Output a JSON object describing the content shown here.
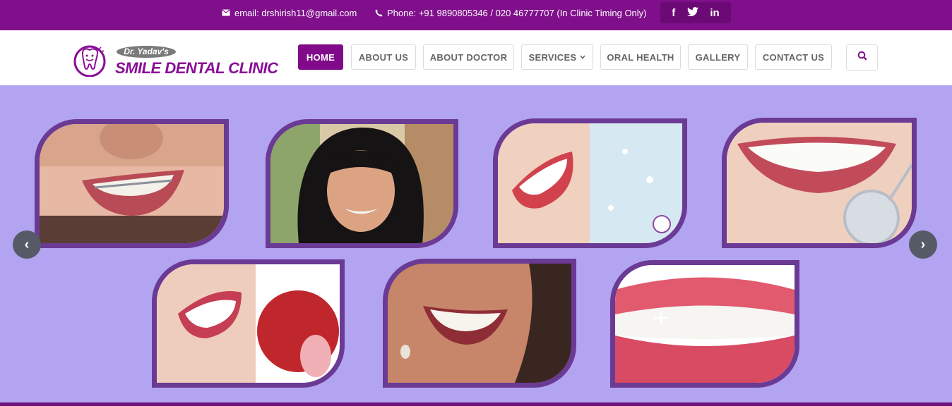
{
  "topbar": {
    "email": "email: drshirish11@gmail.com",
    "phone": "Phone: +91 9890805346 / 020 46777707 (In Clinic Timing Only)",
    "social": [
      {
        "icon": "facebook-icon",
        "glyph": "f"
      },
      {
        "icon": "twitter-icon",
        "glyph": "t"
      },
      {
        "icon": "linkedin-icon",
        "glyph": "in"
      }
    ]
  },
  "logo": {
    "doctor": "Dr. Yadav's",
    "clinic": "SMILE DENTAL CLINIC"
  },
  "nav": [
    {
      "label": "HOME",
      "active": true
    },
    {
      "label": "ABOUT US",
      "active": false
    },
    {
      "label": "ABOUT DOCTOR",
      "active": false
    },
    {
      "label": "SERVICES",
      "active": false,
      "dropdown": true
    },
    {
      "label": "ORAL HEALTH",
      "active": false
    },
    {
      "label": "GALLERY",
      "active": false
    },
    {
      "label": "CONTACT US",
      "active": false
    }
  ],
  "slider": {
    "prev_glyph": "‹",
    "next_glyph": "›",
    "images": [
      {
        "name": "smile-braces-closeup",
        "shape": "a"
      },
      {
        "name": "girl-with-braces",
        "shape": "a"
      },
      {
        "name": "white-teeth-snowflakes",
        "shape": "a"
      },
      {
        "name": "teeth-dental-mirror",
        "shape": "a"
      },
      {
        "name": "smile-with-apple",
        "shape": "a"
      },
      {
        "name": "woman-smile",
        "shape": "a"
      },
      {
        "name": "sparkling-white-teeth",
        "shape": "a"
      }
    ]
  },
  "colors": {
    "brand": "#7f0f8a",
    "slider_bg": "#b2a4f1",
    "tile_border": "#6a3a95"
  }
}
